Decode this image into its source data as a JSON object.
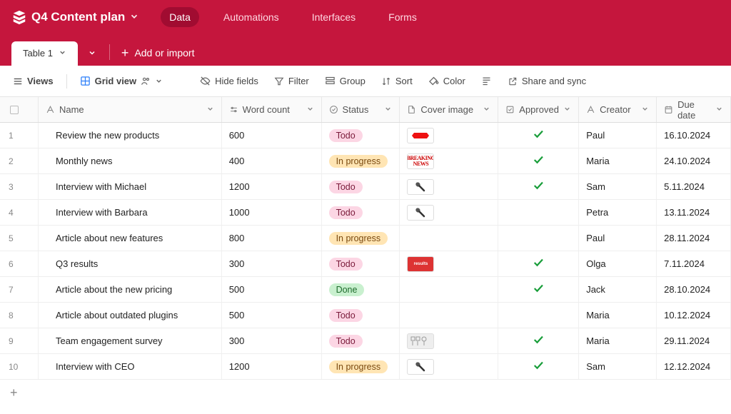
{
  "header": {
    "base_name": "Q4 Content plan",
    "tabs": {
      "data": "Data",
      "automations": "Automations",
      "interfaces": "Interfaces",
      "forms": "Forms"
    }
  },
  "tablebar": {
    "active_table": "Table 1",
    "add_or_import": "Add or import"
  },
  "toolbar": {
    "views": "Views",
    "grid_view": "Grid view",
    "hide_fields": "Hide fields",
    "filter": "Filter",
    "group": "Group",
    "sort": "Sort",
    "color": "Color",
    "share_and_sync": "Share and sync"
  },
  "columns": {
    "name": "Name",
    "word_count": "Word count",
    "status": "Status",
    "cover_image": "Cover image",
    "approved": "Approved",
    "creator": "Creator",
    "due_date": "Due date"
  },
  "status_labels": {
    "todo": "Todo",
    "inprogress": "In progress",
    "done": "Done"
  },
  "rows": [
    {
      "n": "1",
      "name": "Review the new products",
      "word_count": "600",
      "status": "todo",
      "cover": "sale",
      "approved": true,
      "creator": "Paul",
      "due_date": "16.10.2024"
    },
    {
      "n": "2",
      "name": "Monthly news",
      "word_count": "400",
      "status": "inprogress",
      "cover": "breaking",
      "approved": true,
      "creator": "Maria",
      "due_date": "24.10.2024"
    },
    {
      "n": "3",
      "name": "Interview with Michael",
      "word_count": "1200",
      "status": "todo",
      "cover": "mic",
      "approved": true,
      "creator": "Sam",
      "due_date": "5.11.2024"
    },
    {
      "n": "4",
      "name": "Interview with Barbara",
      "word_count": "1000",
      "status": "todo",
      "cover": "mic",
      "approved": false,
      "creator": "Petra",
      "due_date": "13.11.2024"
    },
    {
      "n": "5",
      "name": "Article about new features",
      "word_count": "800",
      "status": "inprogress",
      "cover": "",
      "approved": false,
      "creator": "Paul",
      "due_date": "28.11.2024"
    },
    {
      "n": "6",
      "name": "Q3 results",
      "word_count": "300",
      "status": "todo",
      "cover": "results",
      "approved": true,
      "creator": "Olga",
      "due_date": "7.11.2024"
    },
    {
      "n": "7",
      "name": "Article about the new pricing",
      "word_count": "500",
      "status": "done",
      "cover": "",
      "approved": true,
      "creator": "Jack",
      "due_date": "28.10.2024"
    },
    {
      "n": "8",
      "name": "Article about outdated plugins",
      "word_count": "500",
      "status": "todo",
      "cover": "",
      "approved": false,
      "creator": "Maria",
      "due_date": "10.12.2024"
    },
    {
      "n": "9",
      "name": "Team engagement survey",
      "word_count": "300",
      "status": "todo",
      "cover": "survey",
      "approved": true,
      "creator": "Maria",
      "due_date": "29.11.2024"
    },
    {
      "n": "10",
      "name": "Interview with CEO",
      "word_count": "1200",
      "status": "inprogress",
      "cover": "mic",
      "approved": true,
      "creator": "Sam",
      "due_date": "12.12.2024"
    }
  ]
}
